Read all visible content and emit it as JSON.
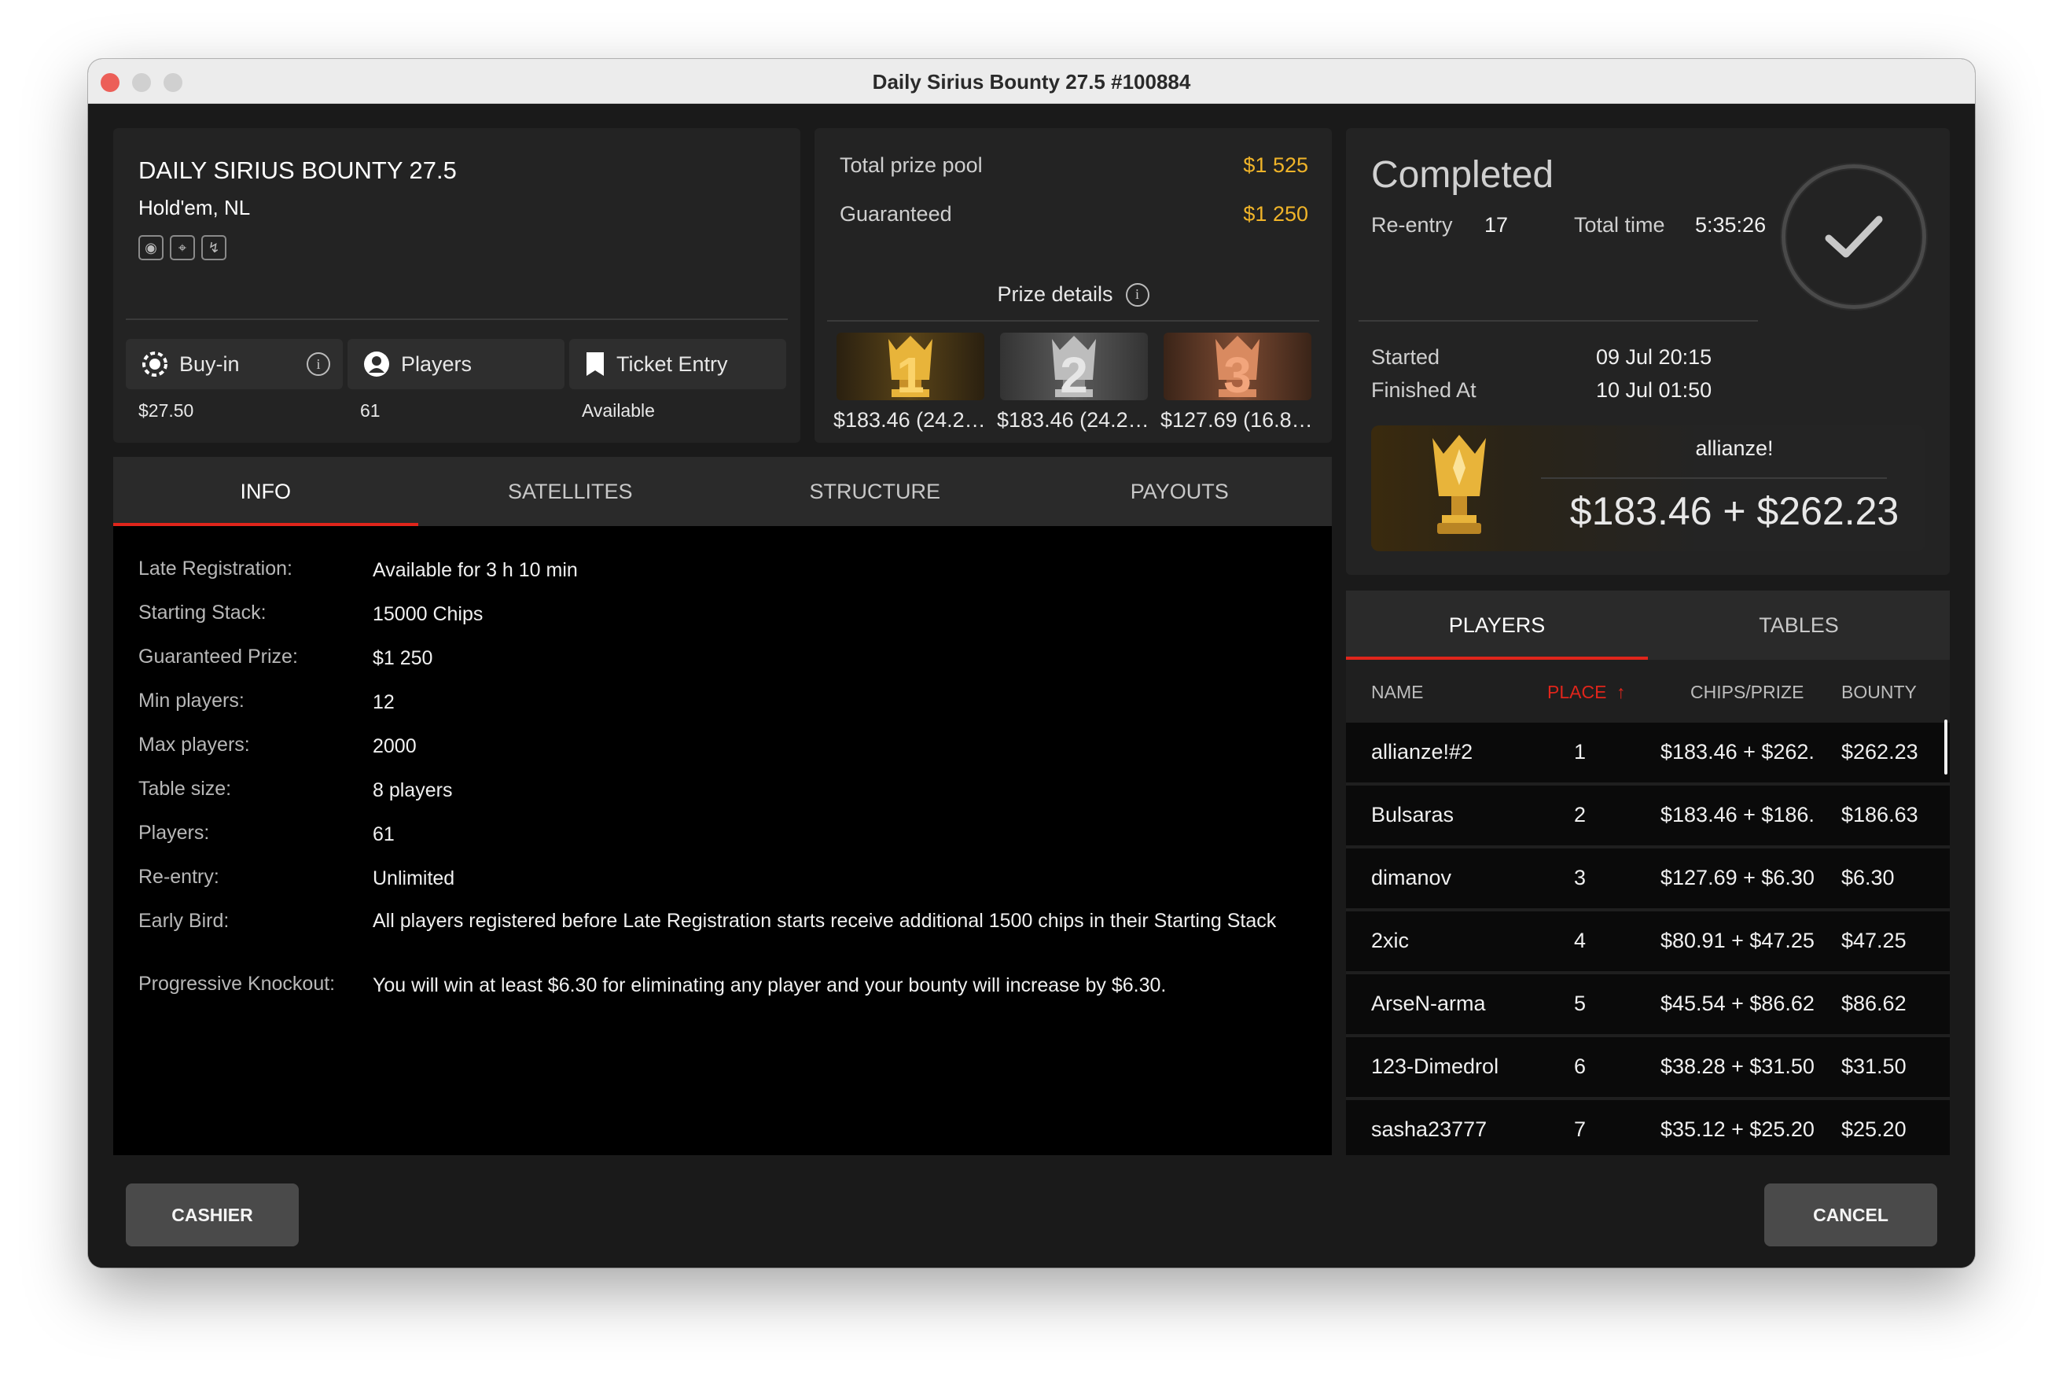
{
  "window": {
    "title": "Daily Sirius Bounty 27.5 #100884"
  },
  "tournament": {
    "name": "DAILY SIRIUS BOUNTY 27.5",
    "game": "Hold'em, NL",
    "buyin_label": "Buy-in",
    "buyin_value": "$27.50",
    "players_label": "Players",
    "players_value": "61",
    "ticket_label": "Ticket Entry",
    "ticket_value": "Available"
  },
  "prize": {
    "pool_label": "Total prize pool",
    "pool_value": "$1 525",
    "guaranteed_label": "Guaranteed",
    "guaranteed_value": "$1 250",
    "details_label": "Prize details",
    "trophies": [
      {
        "place": "1",
        "amount": "$183.46 (24.2…"
      },
      {
        "place": "2",
        "amount": "$183.46 (24.2…"
      },
      {
        "place": "3",
        "amount": "$127.69 (16.8…"
      }
    ]
  },
  "tabs": [
    "INFO",
    "SATELLITES",
    "STRUCTURE",
    "PAYOUTS"
  ],
  "info": [
    {
      "key": "Late Registration:",
      "value": "Available for 3 h 10 min"
    },
    {
      "key": "Starting Stack:",
      "value": "15000 Chips"
    },
    {
      "key": "Guaranteed Prize:",
      "value": "$1 250"
    },
    {
      "key": "Min players:",
      "value": "12"
    },
    {
      "key": "Max players:",
      "value": "2000"
    },
    {
      "key": "Table size:",
      "value": "8 players"
    },
    {
      "key": "Players:",
      "value": "61"
    },
    {
      "key": "Re-entry:",
      "value": "Unlimited"
    },
    {
      "key": "Early Bird:",
      "value": "All players registered before Late Registration starts receive additional 1500 chips in their Starting Stack"
    },
    {
      "key": "Progressive Knockout:",
      "value": "You will win at least $6.30 for eliminating any player and your bounty will increase by $6.30."
    }
  ],
  "status": {
    "title": "Completed",
    "reentry_label": "Re-entry",
    "reentry_value": "17",
    "total_time_label": "Total time",
    "total_time_value": "5:35:26",
    "started_label": "Started",
    "started_value": "09 Jul 20:15",
    "finished_label": "Finished At",
    "finished_value": "10 Jul 01:50",
    "winner_name": "allianze!",
    "winner_amount": "$183.46 + $262.23"
  },
  "player_tabs": [
    "PLAYERS",
    "TABLES"
  ],
  "player_columns": {
    "name": "NAME",
    "place": "PLACE",
    "place_sort": "↑",
    "prize": "CHIPS/PRIZE",
    "bounty": "BOUNTY"
  },
  "players": [
    {
      "name": "allianze!#2",
      "place": "1",
      "prize": "$183.46 + $262.",
      "bounty": "$262.23"
    },
    {
      "name": "Bulsaras",
      "place": "2",
      "prize": "$183.46 + $186.",
      "bounty": "$186.63"
    },
    {
      "name": "dimanov",
      "place": "3",
      "prize": "$127.69 + $6.30",
      "bounty": "$6.30"
    },
    {
      "name": "2xic",
      "place": "4",
      "prize": "$80.91 + $47.25",
      "bounty": "$47.25"
    },
    {
      "name": "ArseN-arma",
      "place": "5",
      "prize": "$45.54 + $86.62",
      "bounty": "$86.62"
    },
    {
      "name": "123-Dimedrol",
      "place": "6",
      "prize": "$38.28 + $31.50",
      "bounty": "$31.50"
    },
    {
      "name": "sasha23777",
      "place": "7",
      "prize": "$35.12 + $25.20",
      "bounty": "$25.20"
    }
  ],
  "footer": {
    "cashier": "CASHIER",
    "cancel": "CANCEL"
  },
  "colors": {
    "accent_red": "#e0251b",
    "gold": "#f0b429",
    "active_place_header": "#e0251b"
  }
}
